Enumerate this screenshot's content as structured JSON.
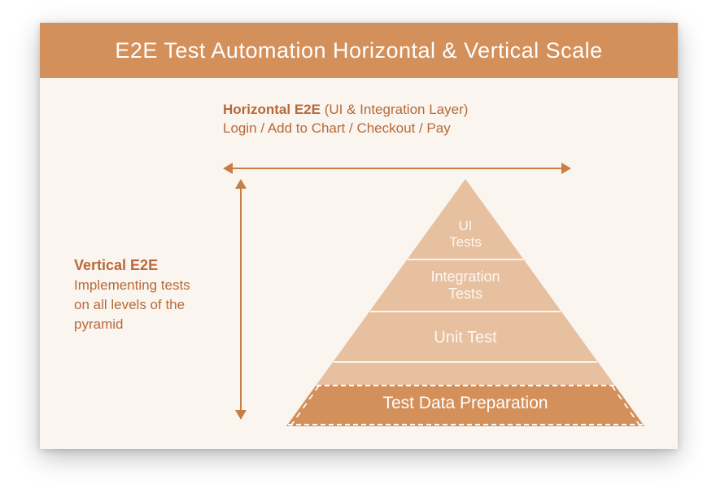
{
  "title": "E2E Test Automation Horizontal & Vertical Scale",
  "horizontal": {
    "bold": "Horizontal E2E",
    "sub": "(UI & Integration Layer)",
    "line2": "Login / Add to Chart / Checkout / Pay"
  },
  "vertical": {
    "bold": "Vertical E2E",
    "body": "Implementing tests on all levels of the pyramid"
  },
  "pyramid": {
    "ui1": "UI",
    "ui2": "Tests",
    "int1": "Integration",
    "int2": "Tests",
    "unit": "Unit Test",
    "base": "Test Data Preparation"
  }
}
